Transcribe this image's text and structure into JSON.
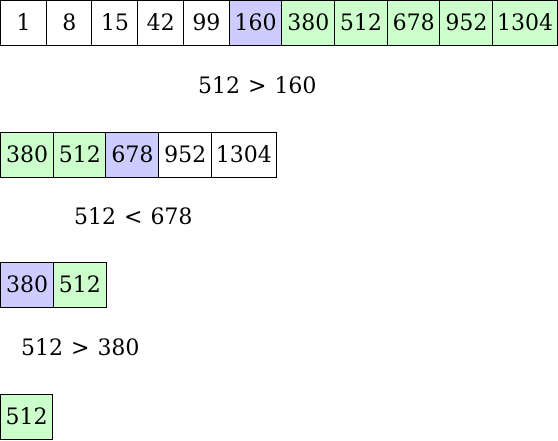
{
  "steps": [
    {
      "cells": [
        {
          "value": "1",
          "state": "default"
        },
        {
          "value": "8",
          "state": "default"
        },
        {
          "value": "15",
          "state": "default"
        },
        {
          "value": "42",
          "state": "default"
        },
        {
          "value": "99",
          "state": "default"
        },
        {
          "value": "160",
          "state": "pivot"
        },
        {
          "value": "380",
          "state": "active"
        },
        {
          "value": "512",
          "state": "active"
        },
        {
          "value": "678",
          "state": "active"
        },
        {
          "value": "952",
          "state": "active"
        },
        {
          "value": "1304",
          "state": "active"
        }
      ],
      "comparison": {
        "left": "512",
        "op": ">",
        "right": "160"
      }
    },
    {
      "cells": [
        {
          "value": "380",
          "state": "active"
        },
        {
          "value": "512",
          "state": "active"
        },
        {
          "value": "678",
          "state": "pivot"
        },
        {
          "value": "952",
          "state": "default"
        },
        {
          "value": "1304",
          "state": "default"
        }
      ],
      "comparison": {
        "left": "512",
        "op": "<",
        "right": "678"
      }
    },
    {
      "cells": [
        {
          "value": "380",
          "state": "pivot"
        },
        {
          "value": "512",
          "state": "active"
        }
      ],
      "comparison": {
        "left": "512",
        "op": ">",
        "right": "380"
      }
    },
    {
      "cells": [
        {
          "value": "512",
          "state": "active"
        }
      ]
    }
  ],
  "colors": {
    "pivot": "#ccccff",
    "active": "#ccffcc",
    "default": "#ffffff",
    "border": "#000000"
  }
}
